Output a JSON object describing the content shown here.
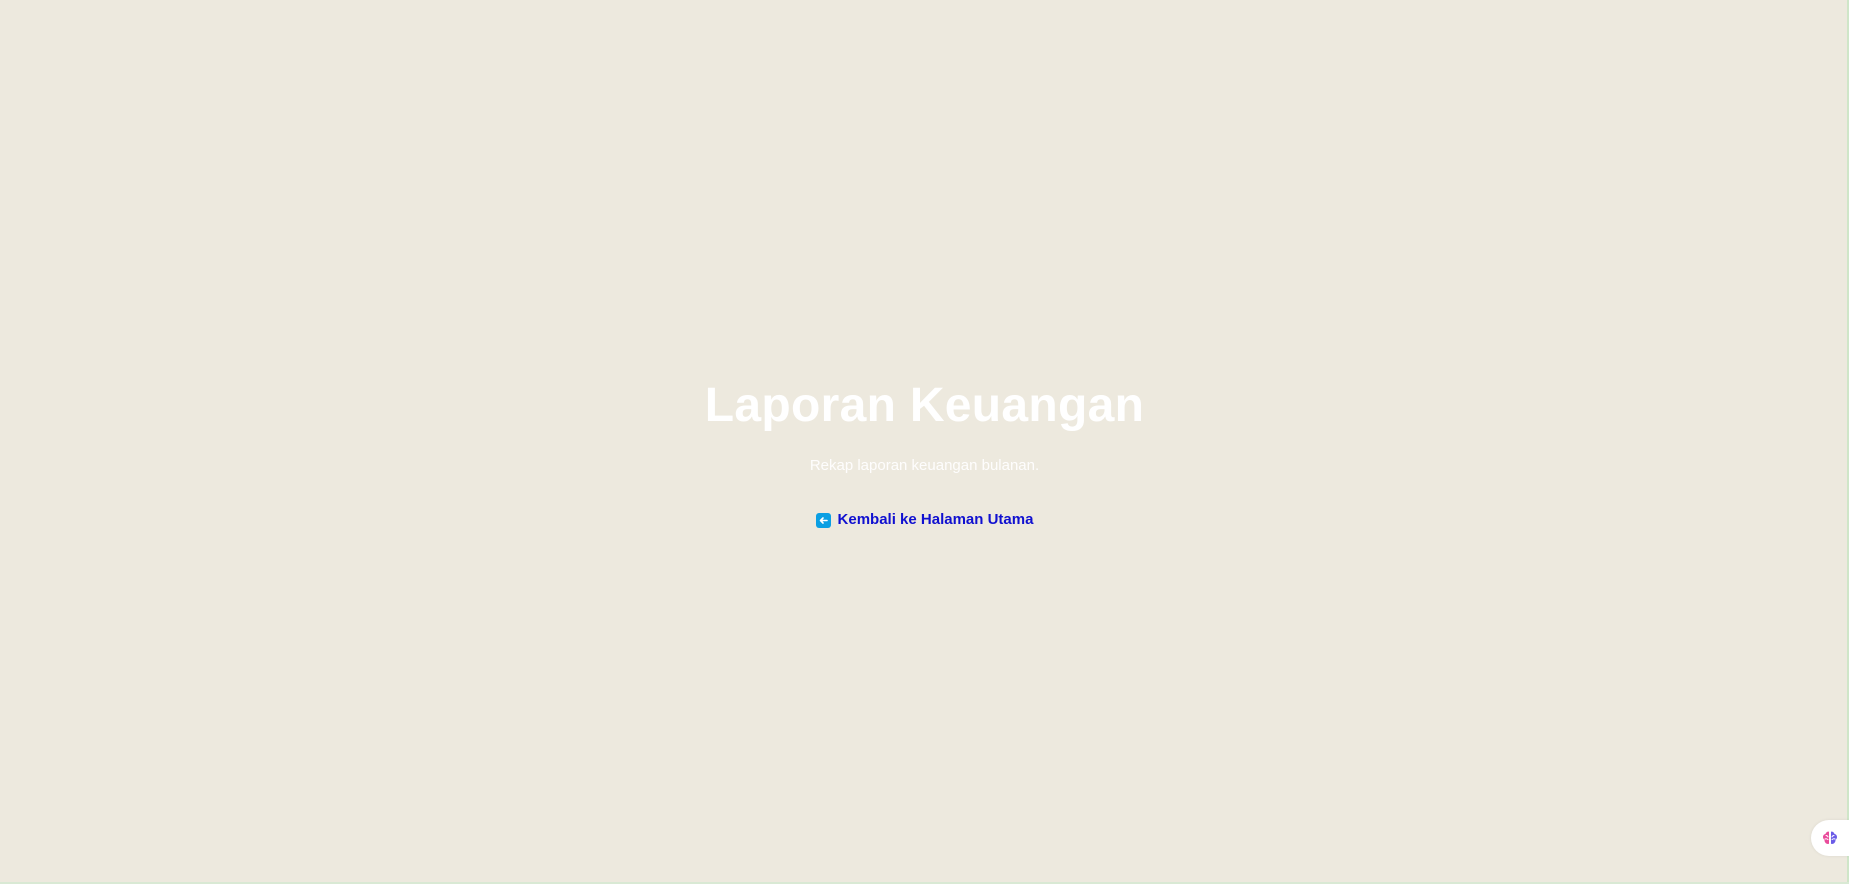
{
  "main": {
    "title": "Laporan Keuangan",
    "subtitle": "Rekap laporan keuangan bulanan.",
    "back_link_label": "Kembali ke Halaman Utama"
  },
  "icons": {
    "back": "left-arrow-icon",
    "floating": "brain-icon"
  },
  "colors": {
    "background": "#ede9de",
    "title": "#ffffff",
    "subtitle": "#ffffff",
    "link": "#1010d0",
    "back_icon_bg": "#0a9fe3"
  }
}
